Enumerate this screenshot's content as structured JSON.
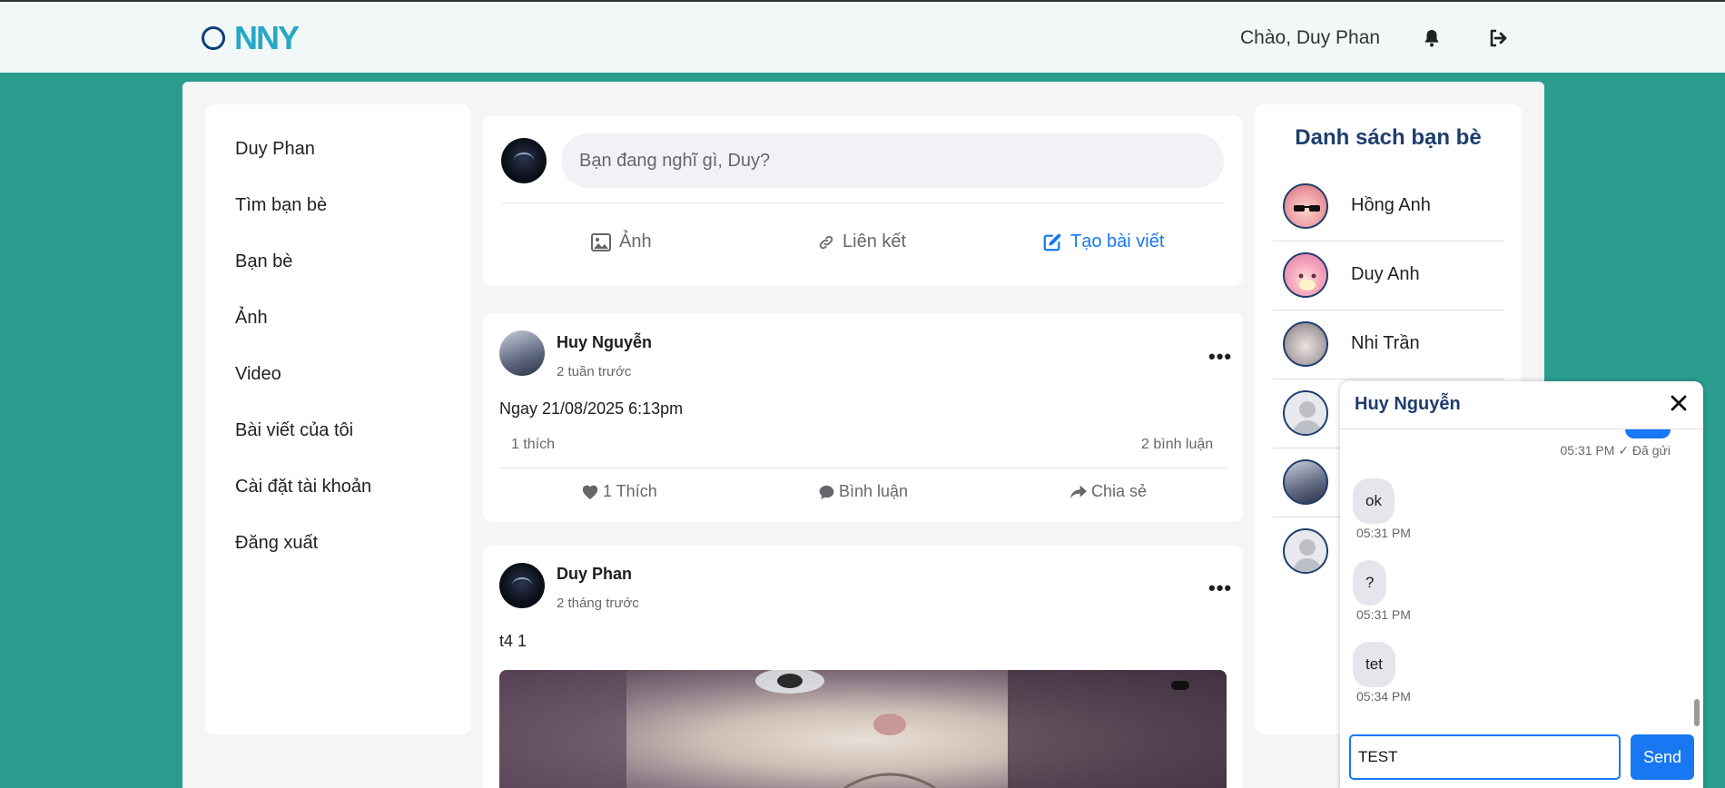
{
  "header": {
    "logo_text": "NNY",
    "greeting": "Chào, Duy Phan"
  },
  "sidebar": {
    "items": [
      {
        "label": "Duy Phan"
      },
      {
        "label": "Tìm bạn bè"
      },
      {
        "label": "Bạn bè"
      },
      {
        "label": "Ảnh"
      },
      {
        "label": "Video"
      },
      {
        "label": "Bài viết của tôi"
      },
      {
        "label": "Cài đặt tài khoản"
      },
      {
        "label": "Đăng xuất"
      }
    ]
  },
  "composer": {
    "placeholder": "Bạn đang nghĩ gì, Duy?",
    "photo_label": "Ảnh",
    "link_label": "Liên kết",
    "create_label": "Tạo bài viết"
  },
  "posts": [
    {
      "author": "Huy Nguyễn",
      "time": "2 tuần trước",
      "text": "Ngay 21/08/2025 6:13pm",
      "likes": "1 thích",
      "comments": "2 bình luận",
      "like_label": "1 Thích",
      "comment_label": "Bình luận",
      "share_label": "Chia sẻ"
    },
    {
      "author": "Duy Phan",
      "time": "2 tháng trước",
      "text": "t4 1"
    }
  ],
  "friends": {
    "title": "Danh sách bạn bè",
    "items": [
      {
        "name": "Hồng Anh"
      },
      {
        "name": "Duy Anh"
      },
      {
        "name": "Nhi Trần"
      }
    ]
  },
  "chat": {
    "title": "Huy Nguyễn",
    "sent_meta": "05:31 PM ✓ Đã gửi",
    "messages": [
      {
        "text": "ok",
        "time": "05:31 PM"
      },
      {
        "text": "?",
        "time": "05:31 PM"
      },
      {
        "text": "tet",
        "time": "05:34 PM"
      }
    ],
    "input_value": "TEST",
    "send_label": "Send"
  },
  "colors": {
    "background": "#2a9d8f",
    "accent": "#1877f2",
    "title_navy": "#1d3e6e"
  }
}
